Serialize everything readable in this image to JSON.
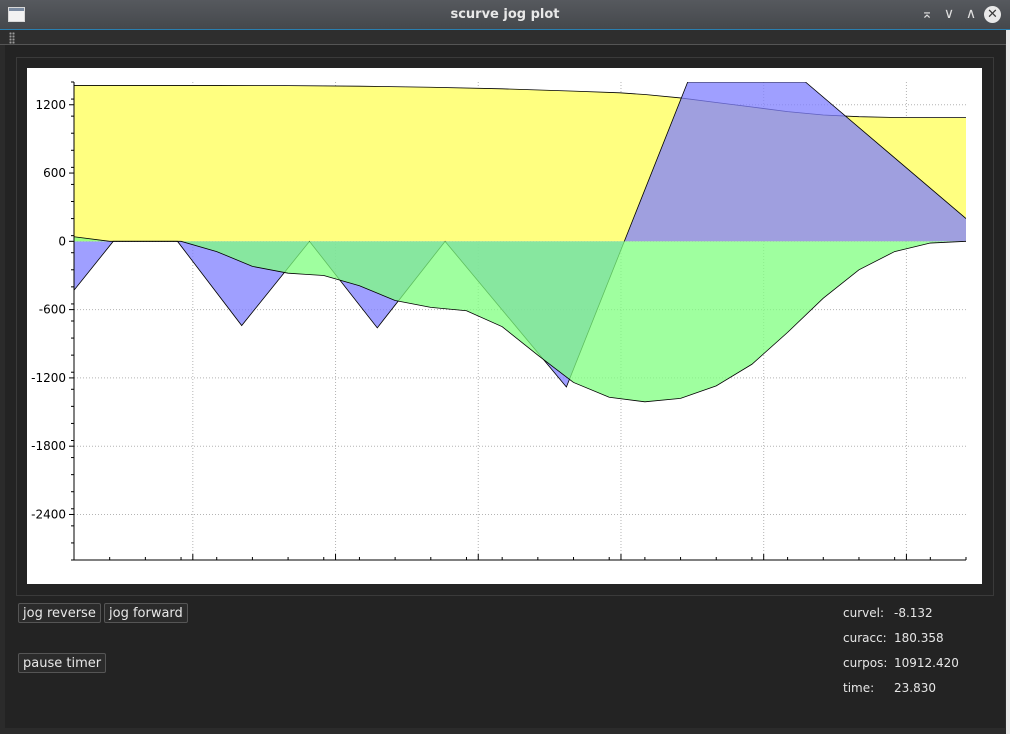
{
  "window": {
    "title": "scurve jog plot",
    "icons": {
      "app": "app-window-icon",
      "keep_above": "keep-above-icon",
      "minimize": "minimize-icon",
      "maximize": "maximize-icon",
      "close": "close-icon"
    },
    "glyphs": {
      "keep_above": "⌅",
      "minimize": "∨",
      "maximize": "∧",
      "close": "✕"
    }
  },
  "chart_data": {
    "type": "area",
    "xlim": [
      0,
      25
    ],
    "ylim": [
      -2800,
      1400
    ],
    "yticks": [
      1200,
      600,
      0,
      -600,
      -1200,
      -1800,
      -2400
    ],
    "ytick_labels": [
      "1200",
      "600",
      "0",
      "-600",
      "-1200",
      "-1800",
      "-2400"
    ],
    "xticks": [
      3.33,
      7.33,
      11.33,
      15.33,
      19.33,
      23.33
    ],
    "grid": true,
    "colors": {
      "velocity_fill": "#ffff80",
      "acceleration_fill": "#7f7fff",
      "jerk_fill": "#7fff7f",
      "axis": "#000000",
      "grid": "#b4b4b4"
    },
    "series": [
      {
        "x": [
          0,
          2,
          4,
          6,
          8,
          10,
          12,
          14,
          15.3,
          16,
          17,
          18,
          19,
          20,
          21,
          22,
          23,
          24,
          25
        ],
        "values": [
          1370,
          1370,
          1370,
          1368,
          1363,
          1354,
          1340,
          1320,
          1305,
          1290,
          1260,
          1220,
          1180,
          1140,
          1110,
          1095,
          1088,
          1087,
          1087
        ]
      },
      {
        "x": [
          0,
          1.1,
          2.9,
          4.7,
          6.6,
          8.5,
          10.4,
          13.8,
          17.2,
          20.5,
          25
        ],
        "values": [
          -430,
          0,
          0,
          -740,
          0,
          -760,
          0,
          -1280,
          1400,
          1400,
          200
        ]
      },
      {
        "x": [
          0,
          1,
          2,
          3,
          4,
          5,
          6,
          6.5,
          7,
          8,
          9,
          10,
          11,
          12,
          13,
          14,
          15,
          16,
          17,
          18,
          19,
          20,
          21,
          22,
          23,
          24,
          25
        ],
        "values": [
          40,
          0,
          0,
          0,
          -90,
          -220,
          -280,
          -290,
          -300,
          -390,
          -520,
          -580,
          -610,
          -750,
          -1000,
          -1240,
          -1370,
          -1410,
          -1380,
          -1270,
          -1080,
          -800,
          -500,
          -250,
          -90,
          -15,
          0
        ]
      }
    ]
  },
  "buttons": {
    "jog_reverse": "jog reverse",
    "jog_forward": "jog forward",
    "pause_timer": "pause timer"
  },
  "readouts": [
    {
      "label": "curvel:",
      "value": "-8.132"
    },
    {
      "label": "curacc:",
      "value": "180.358"
    },
    {
      "label": "curpos:",
      "value": "10912.420"
    },
    {
      "label": "time:",
      "value": "23.830"
    }
  ]
}
